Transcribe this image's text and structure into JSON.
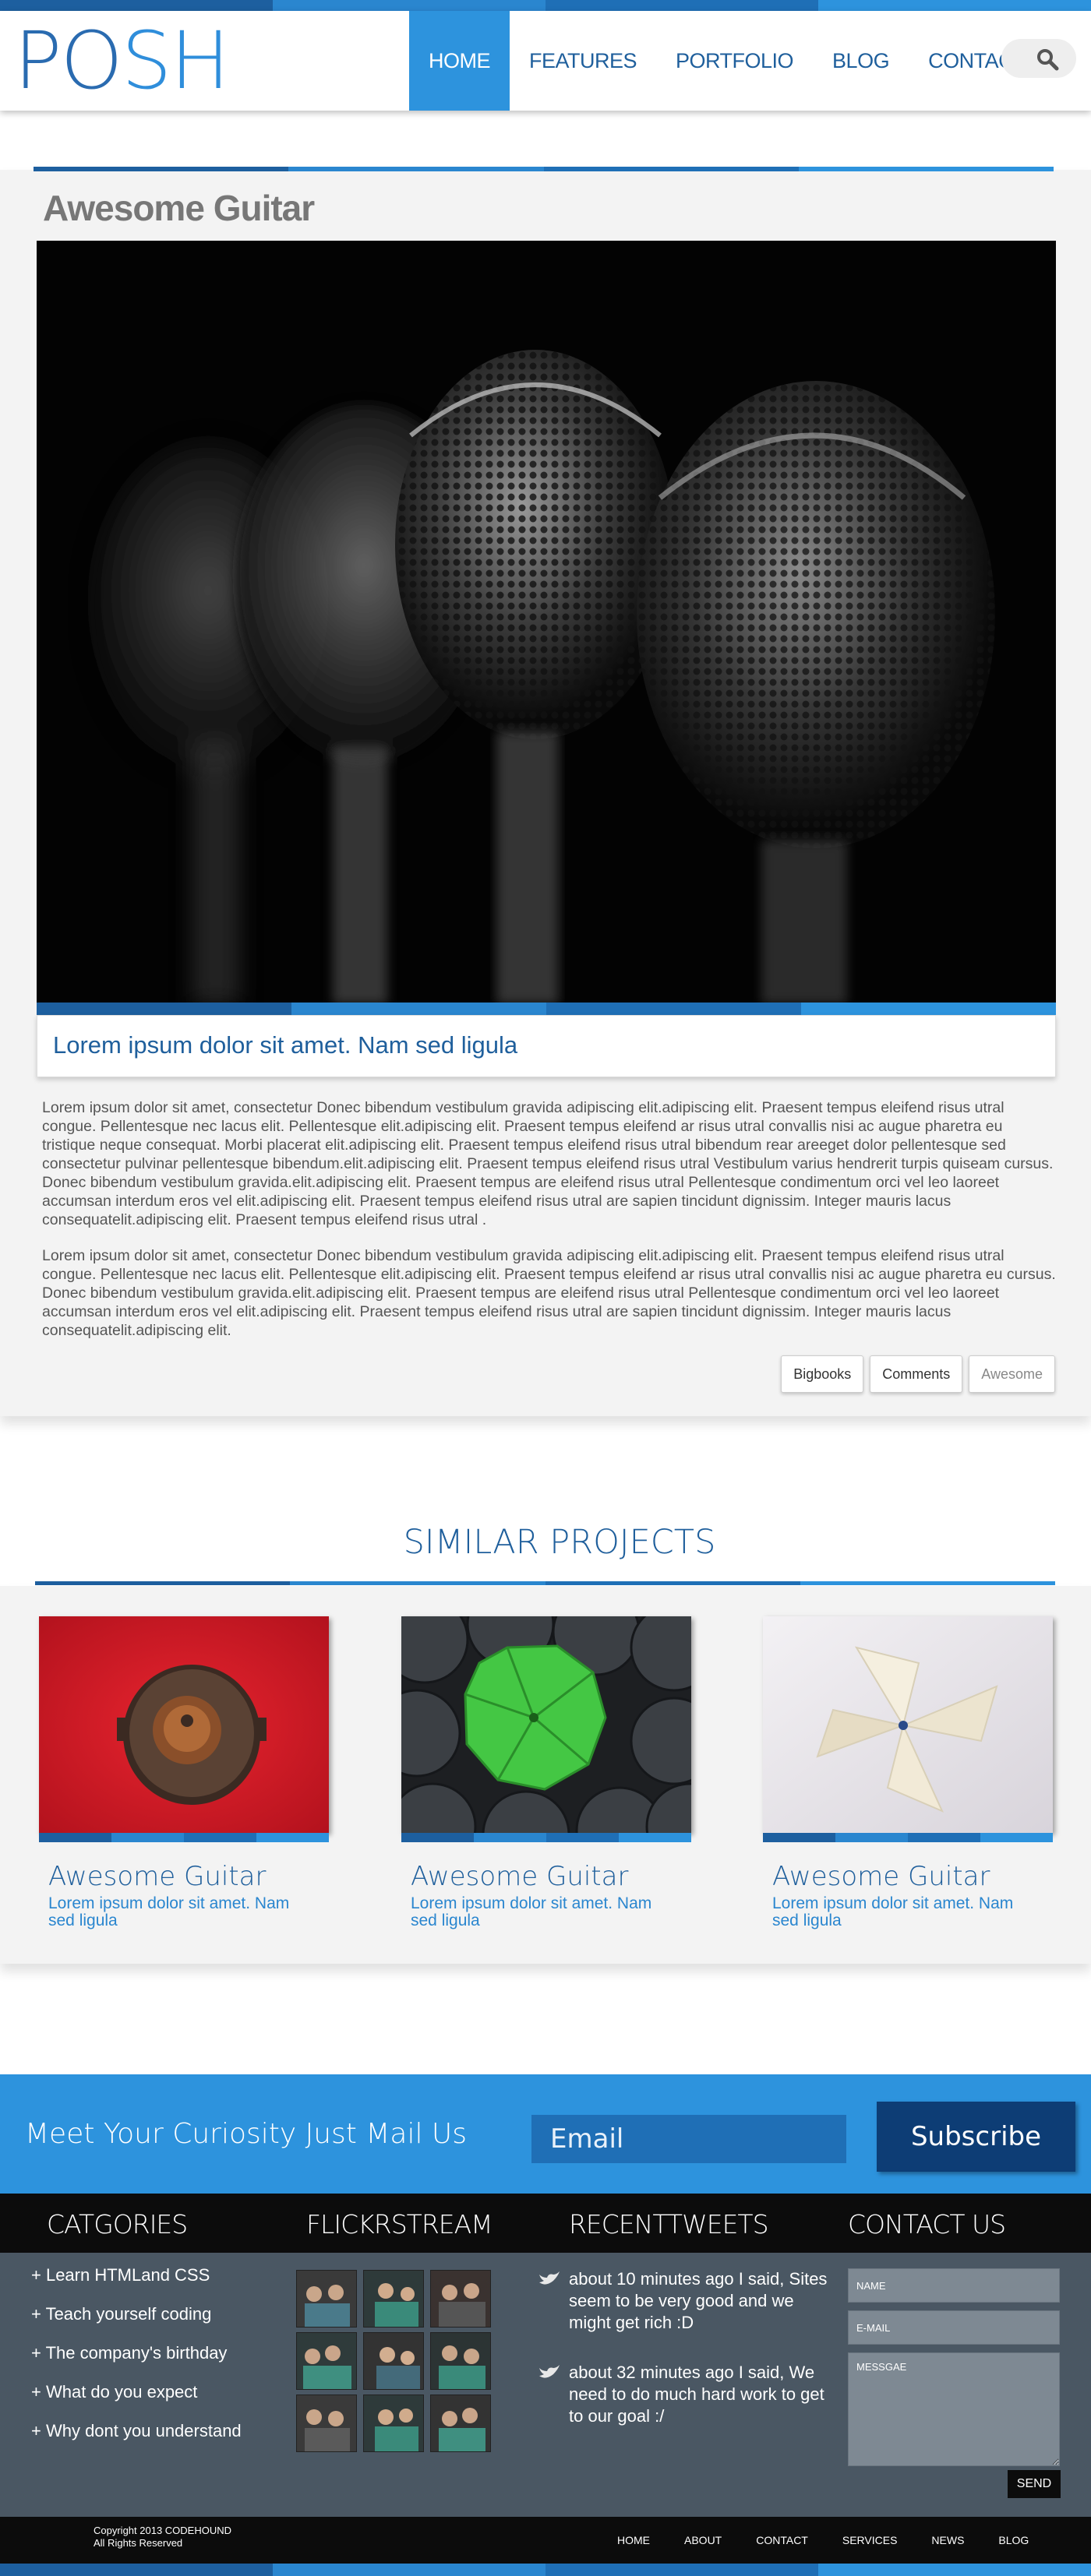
{
  "header": {
    "logo": "POSH",
    "nav": [
      "HOME",
      "FEATURES",
      "PORTFOLIO",
      "BLOG",
      "CONTACT"
    ],
    "active_nav": "HOME"
  },
  "article": {
    "title": "Awesome Guitar",
    "caption": "Lorem ipsum dolor sit amet.  Nam sed ligula",
    "para1": "Lorem ipsum dolor sit amet, consectetur Donec bibendum vestibulum gravida adipiscing elit.adipiscing elit. Praesent tempus eleifend risus utral congue. Pellentesque nec lacus elit. Pellentesque elit.adipiscing elit. Praesent tempus eleifend ar risus utral  convallis nisi ac augue pharetra eu tristique neque consequat. Morbi placerat elit.adipiscing elit. Praesent tempus eleifend risus utral bibendum rear areeget dolor pellentesque sed consectetur pulvinar pellentesque bibendum.elit.adipiscing elit. Praesent tempus eleifend risus utral  Vestibulum varius hendrerit turpis quiseam cursus. Donec bibendum vestibulum gravida.elit.adipiscing elit. Praesent tempus are eleifend risus utral  Pellentesque condimentum orci vel leo laoreet accumsan interdum eros vel elit.adipiscing elit. Praesent tempus eleifend risus utral are  sapien tincidunt dignissim. Integer mauris lacus consequatelit.adipiscing elit. Praesent tempus eleifend risus utral .",
    "para2": "Lorem ipsum dolor sit amet, consectetur Donec bibendum vestibulum gravida adipiscing elit.adipiscing elit. Praesent tempus eleifend risus utral congue. Pellentesque nec lacus elit. Pellentesque elit.adipiscing elit. Praesent tempus eleifend ar risus utral  convallis nisi ac augue pharetra eu cursus. Donec bibendum vestibulum gravida.elit.adipiscing elit. Praesent tempus are eleifend risus utral  Pellentesque condimentum orci vel leo laoreet accumsan interdum eros vel elit.adipiscing elit. Praesent tempus eleifend risus utral are  sapien tincidunt dignissim. Integer mauris lacus consequatelit.adipiscing elit.",
    "tags": [
      "Bigbooks",
      "Comments",
      "Awesome"
    ]
  },
  "similar": {
    "heading": "SIMILAR PROJECTS",
    "projects": [
      {
        "title": "Awesome Guitar",
        "desc": "Lorem ipsum dolor sit amet.  Nam sed ligula"
      },
      {
        "title": "Awesome Guitar",
        "desc": "Lorem ipsum dolor sit amet.  Nam sed ligula"
      },
      {
        "title": "Awesome Guitar",
        "desc": "Lorem ipsum dolor sit amet.  Nam sed ligula"
      }
    ]
  },
  "subscribe": {
    "text": "Meet Your Curiosity Just Mail Us",
    "email_placeholder": "Email",
    "button": "Subscribe"
  },
  "footer": {
    "headings": [
      "CATGORIES",
      "FLICKRSTREAM",
      "RECENTTWEETS",
      "CONTACT US"
    ],
    "categories": [
      "+ Learn HTMLand CSS",
      "+ Teach yourself coding",
      "+ The company's birthday",
      "+ What do you expect",
      "+ Why dont you understand"
    ],
    "tweets": [
      "about 10 minutes ago I said, Sites seem to be very good and we might get rich :D",
      "about 32 minutes ago I said, We need to do much hard work to get to our goal :/"
    ],
    "contact": {
      "name_placeholder": "NAME",
      "email_placeholder": "E-MAIL",
      "message_placeholder": "MESSGAE",
      "send": "SEND"
    },
    "copyright_line1": "Copyright 2013 CODEHOUND",
    "copyright_line2": "All Rights Reserved",
    "bottom_nav": [
      "HOME",
      "ABOUT",
      "CONTACT",
      "SERVICES",
      "NEWS",
      "BLOG"
    ]
  },
  "colors": {
    "accent": "#2d93dd",
    "dark_accent": "#1f5f9c",
    "footer_bg": "#4a5763",
    "footer_head_bg": "#0c0c0c"
  }
}
